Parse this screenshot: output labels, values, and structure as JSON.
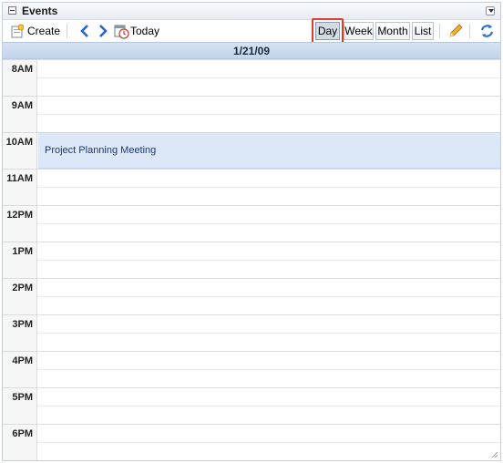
{
  "panel": {
    "title": "Events"
  },
  "toolbar": {
    "create_label": "Create",
    "today_label": "Today",
    "views": {
      "day": "Day",
      "week": "Week",
      "month": "Month",
      "list": "List"
    },
    "selected_view": "Day",
    "icons": [
      "create-icon",
      "prev-arrow-icon",
      "next-arrow-icon",
      "calendar-today-icon",
      "pencil-icon",
      "refresh-icon"
    ]
  },
  "date_header": "1/21/09",
  "hours": [
    "8AM",
    "9AM",
    "10AM",
    "11AM",
    "12PM",
    "1PM",
    "2PM",
    "3PM",
    "4PM",
    "5PM",
    "6PM"
  ],
  "events": [
    {
      "title": "Project Planning Meeting",
      "start": "10AM",
      "end": "11AM"
    }
  ],
  "colors": {
    "accent_highlight": "#e3382a",
    "event_bg": "#dce7f8",
    "date_bar": "#c3d5ec"
  }
}
